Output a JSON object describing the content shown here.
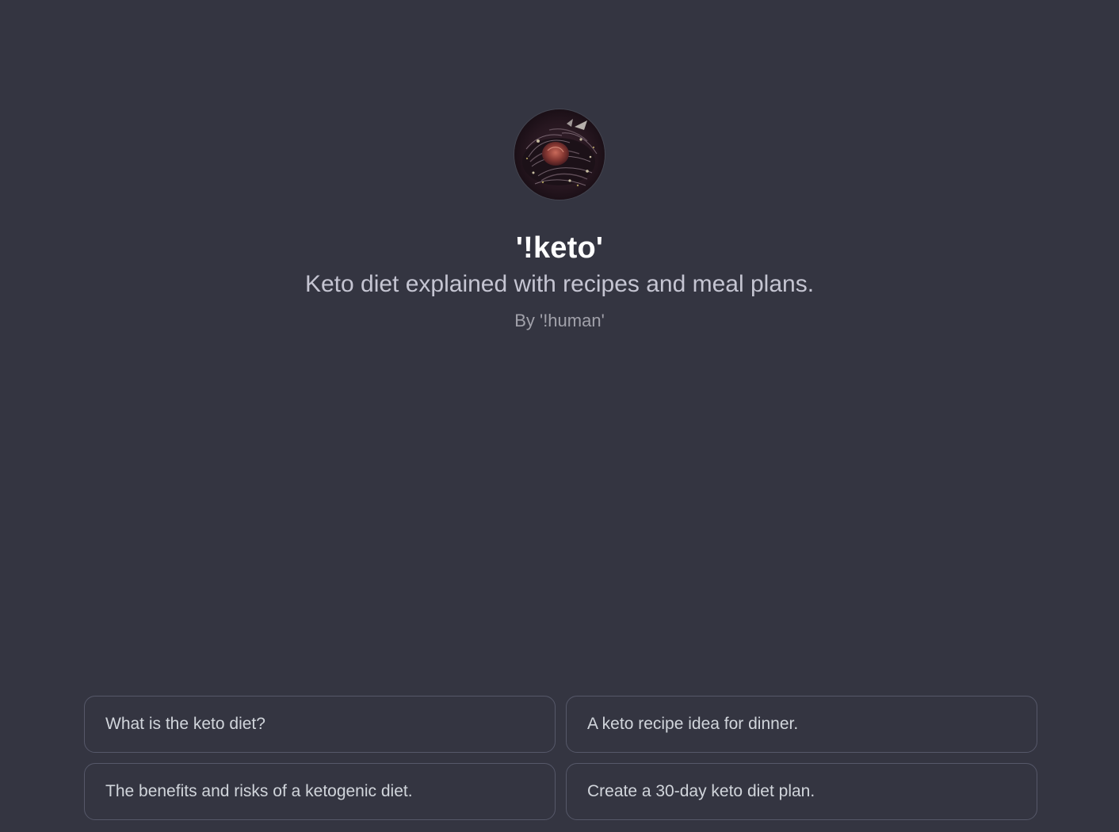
{
  "gpt": {
    "name": "'!keto'",
    "description": "Keto diet explained with recipes and meal plans.",
    "author": "By '!human'"
  },
  "conversation_starters": [
    {
      "label": "What is the keto diet?"
    },
    {
      "label": "A keto recipe idea for dinner."
    },
    {
      "label": "The benefits and risks of a ketogenic diet."
    },
    {
      "label": "Create a 30-day keto diet plan."
    }
  ],
  "colors": {
    "background": "#343541",
    "title": "#ffffff",
    "description": "#c5c5d2",
    "author": "#a1a1aa",
    "card_border": "#565869",
    "card_text": "#d1d5db"
  },
  "icons": {
    "avatar": "keto-dish-photo-avatar"
  }
}
